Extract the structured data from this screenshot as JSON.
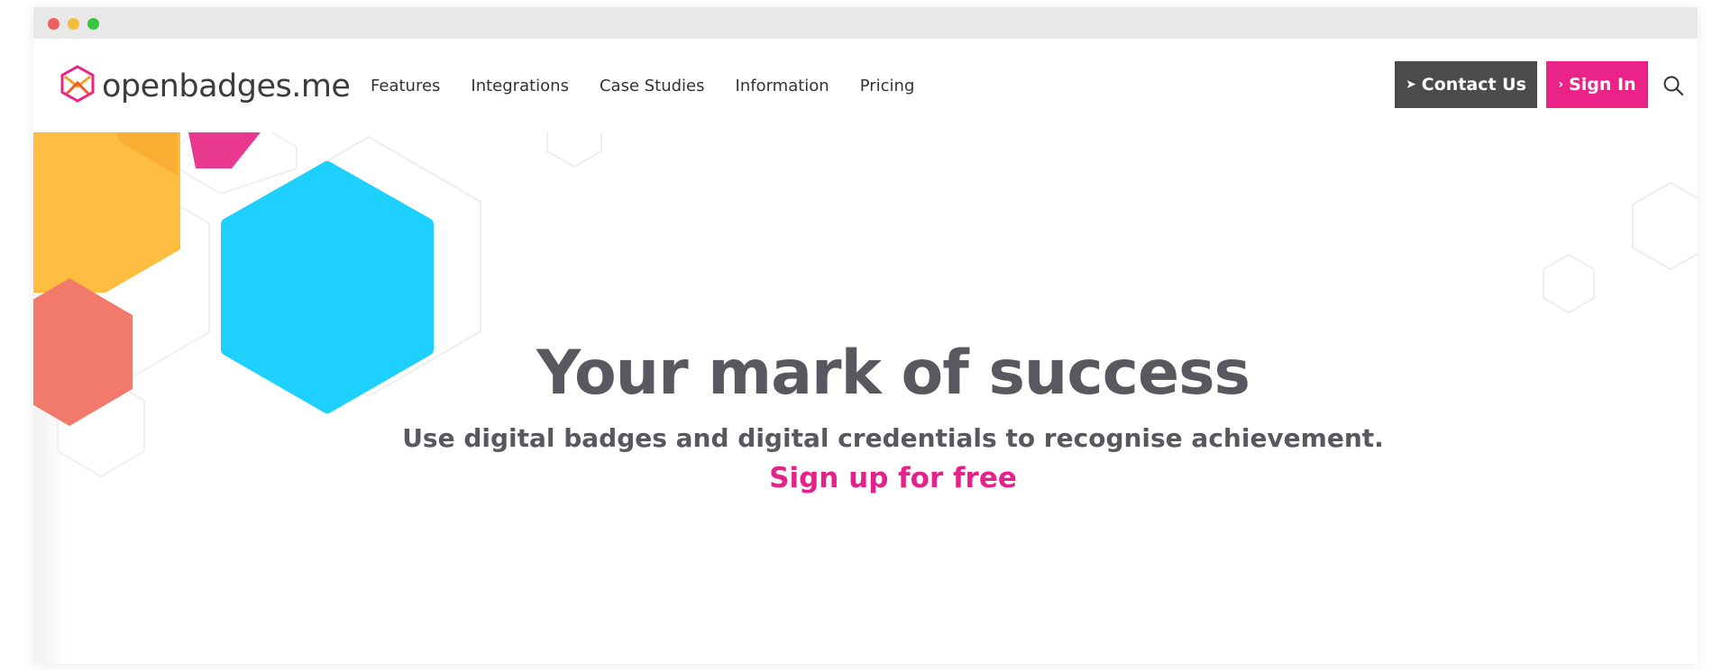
{
  "window": {
    "controls": [
      "close",
      "minimize",
      "maximize"
    ]
  },
  "header": {
    "logo_text": "openbadges.me",
    "logo_icon": "openbadges-logo-icon",
    "nav_items": [
      "Features",
      "Integrations",
      "Case Studies",
      "Information",
      "Pricing"
    ],
    "contact_label": "Contact Us",
    "contact_icon": "paper-plane-icon",
    "signin_label": "Sign In",
    "signin_icon": "chevron-right-icon",
    "search_icon": "search-icon"
  },
  "hero": {
    "headline": "Your mark of success",
    "subheadline": "Use digital badges and digital credentials to recognise achievement.",
    "cta_label": "Sign up for free"
  },
  "colors": {
    "brand_pink": "#ea2389",
    "contact_button": "#4b4b4b",
    "text_dark": "#58585e",
    "hex_cyan": "#1dd1fc",
    "hex_yellow": "#fdbd40",
    "hex_coral": "#f17a6b",
    "hex_magenta": "#e8398f"
  }
}
